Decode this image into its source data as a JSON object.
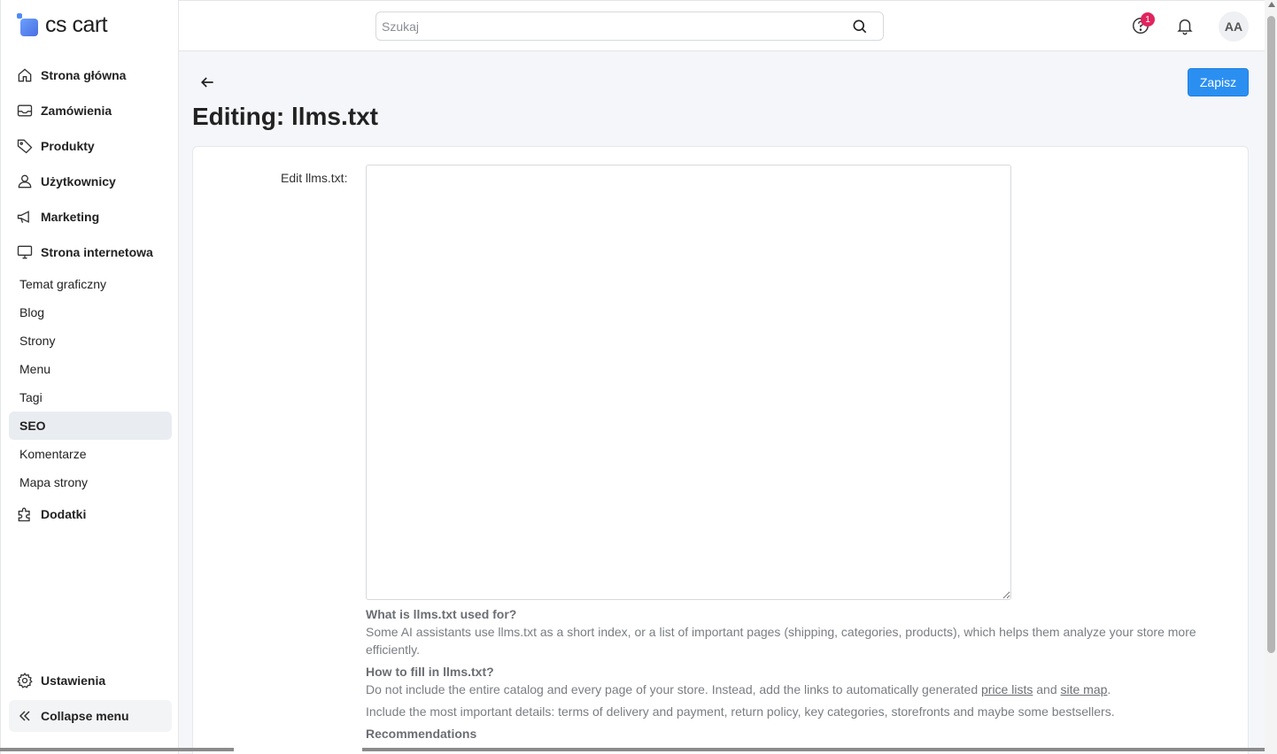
{
  "brand": {
    "logo_text": "cs cart"
  },
  "sidebar": {
    "items": [
      {
        "label": "Strona główna",
        "icon": "home-icon"
      },
      {
        "label": "Zamówienia",
        "icon": "inbox-icon"
      },
      {
        "label": "Produkty",
        "icon": "tag-icon"
      },
      {
        "label": "Użytkownicy",
        "icon": "user-icon"
      },
      {
        "label": "Marketing",
        "icon": "megaphone-icon"
      },
      {
        "label": "Strona internetowa",
        "icon": "monitor-icon"
      }
    ],
    "sub_items": [
      "Temat graficzny",
      "Blog",
      "Strony",
      "Menu",
      "Tagi",
      "SEO",
      "Komentarze",
      "Mapa strony"
    ],
    "active_sub": "SEO",
    "addons": {
      "label": "Dodatki",
      "icon": "puzzle-icon"
    },
    "settings": {
      "label": "Ustawienia",
      "icon": "gear-icon"
    },
    "collapse": {
      "label": "Collapse menu",
      "icon": "double-chevron-left-icon"
    }
  },
  "header": {
    "search_placeholder": "Szukaj",
    "help_badge": "1",
    "avatar_initials": "AA"
  },
  "page": {
    "title": "Editing: llms.txt",
    "save_label": "Zapisz",
    "field_label": "Edit llms.txt:",
    "field_value": "",
    "help": {
      "q1": "What is llms.txt used for?",
      "a1": "Some AI assistants use llms.txt as a short index, or a list of important pages (shipping, categories, products), which helps them analyze your store more efficiently.",
      "q2": "How to fill in llms.txt?",
      "a2_prefix": "Do not include the entire catalog and every page of your store. Instead, add the links to automatically generated ",
      "a2_link1": "price lists",
      "a2_and": " and ",
      "a2_link2": "site map",
      "a2_suffix": ".",
      "a3": "Include the most important details: terms of delivery and payment, return policy, key categories, storefronts and maybe some bestsellers.",
      "recommendations": "Recommendations"
    }
  },
  "colors": {
    "accent": "#2b8ff2",
    "badge": "#e0245e",
    "active_bg": "#e9ecf1"
  }
}
